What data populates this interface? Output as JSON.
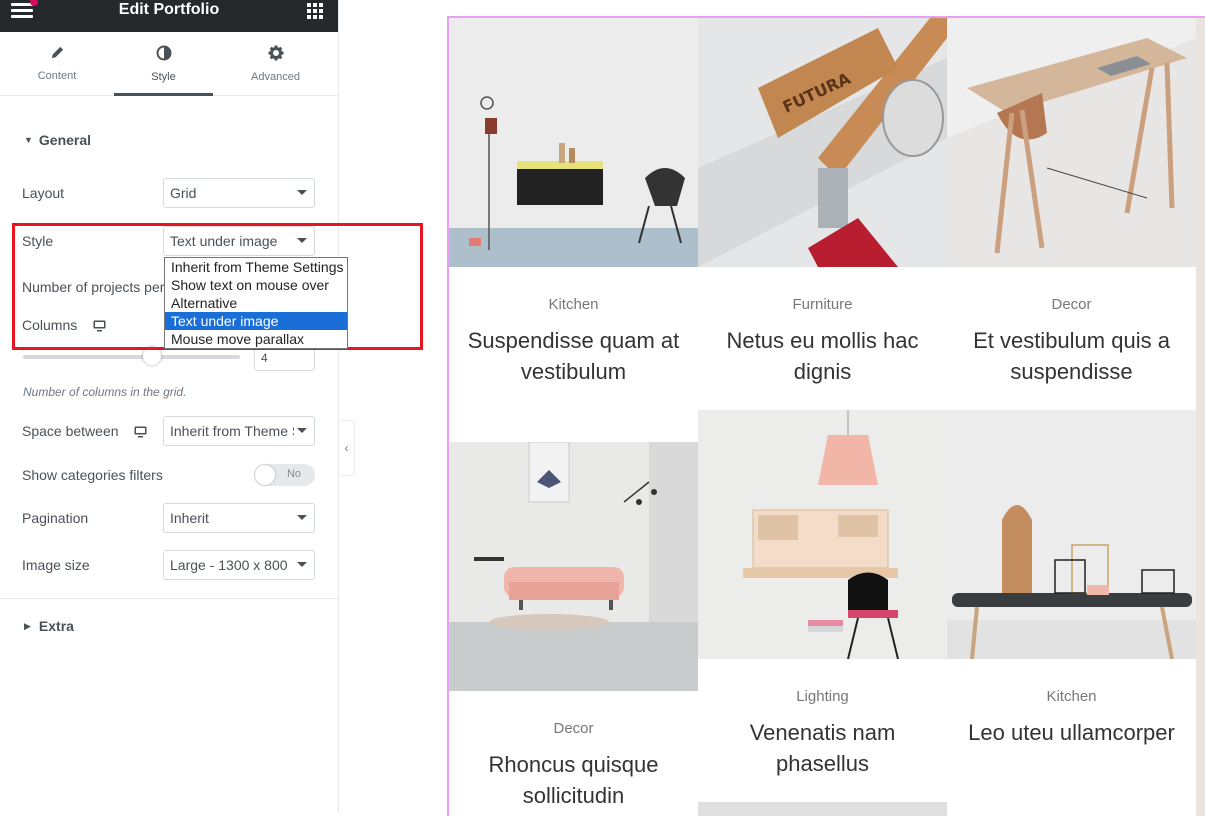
{
  "topbar": {
    "title": "Edit Portfolio"
  },
  "tabs": [
    {
      "label": "Content",
      "icon": "pencil-icon"
    },
    {
      "label": "Style",
      "icon": "contrast-icon"
    },
    {
      "label": "Advanced",
      "icon": "gear-icon"
    }
  ],
  "general": {
    "heading": "General",
    "layout_label": "Layout",
    "layout_value": "Grid",
    "style_label": "Style",
    "style_value": "Text under image",
    "style_options": [
      "Inherit from Theme Settings",
      "Show text on mouse over",
      "Alternative",
      "Text under image",
      "Mouse move parallax"
    ],
    "projects_label": "Number of projects per",
    "columns_label": "Columns",
    "columns_value": "4",
    "columns_help": "Number of columns in the grid.",
    "space_label": "Space between",
    "space_value": "Inherit from Theme S",
    "filters_label": "Show categories filters",
    "filters_toggle": "No",
    "pagination_label": "Pagination",
    "pagination_value": "Inherit",
    "image_size_label": "Image size",
    "image_size_value": "Large - 1300 x 800"
  },
  "extra": {
    "heading": "Extra"
  },
  "portfolio": [
    {
      "category": "Kitchen",
      "title": "Suspendisse quam at vestibulum"
    },
    {
      "category": "Furniture",
      "title": "Netus eu mollis hac dignis"
    },
    {
      "category": "Decor",
      "title": "Et vestibulum quis a suspendisse"
    },
    {
      "category": "Decor",
      "title": "Rhoncus quisque sollicitudin"
    },
    {
      "category": "Lighting",
      "title": "Venenatis nam phasellus"
    },
    {
      "category": "Kitchen",
      "title": "Leo uteu ullamcorper"
    }
  ],
  "colors": {
    "accent_select": "#1a6ed8",
    "highlight_box": "#e8141e",
    "preview_border": "#e7a1f0",
    "topbar": "#26292c"
  }
}
